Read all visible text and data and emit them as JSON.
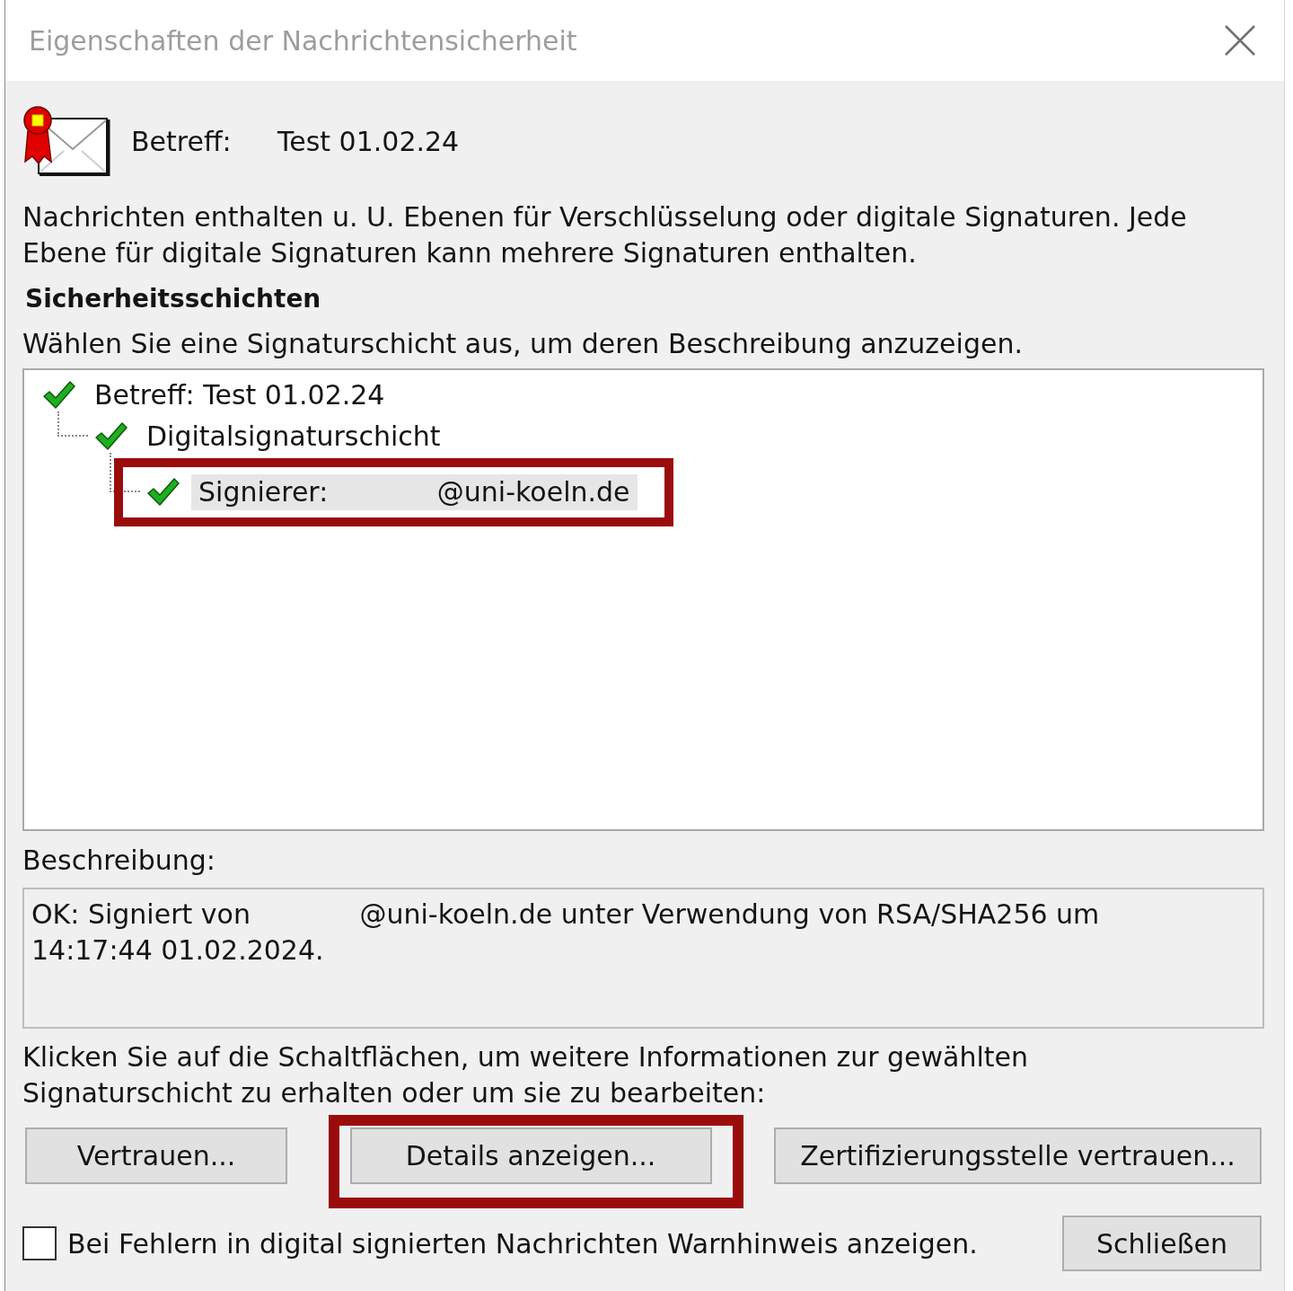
{
  "window": {
    "title": "Eigenschaften der Nachrichtensicherheit"
  },
  "header": {
    "label": "Betreff:",
    "value": "Test 01.02.24"
  },
  "intro": "Nachrichten enthalten u. U. Ebenen für Verschlüsselung oder digitale Signaturen. Jede Ebene für digitale Signaturen kann mehrere Signaturen enthalten.",
  "layers_heading": "Sicherheitsschichten",
  "layers_hint": "Wählen Sie eine Signaturschicht aus, um deren Beschreibung anzuzeigen.",
  "layers_tree": [
    {
      "label": "Betreff: Test 01.02.24",
      "valid": true,
      "selected": false,
      "marked": false,
      "children": [
        {
          "label": "Digitalsignaturschicht",
          "valid": true,
          "selected": false,
          "marked": false,
          "children": [
            {
              "label": "Signierer:",
              "value": "@uni-koeln.de",
              "valid": true,
              "selected": true,
              "marked": true
            }
          ]
        }
      ]
    }
  ],
  "description": {
    "label": "Beschreibung:",
    "segments": [
      "OK: Signiert von",
      "@uni-koeln.de unter Verwendung von RSA/SHA256 um 14:17:44 01.02.2024."
    ]
  },
  "buttons_hint": "Klicken Sie auf die Schaltflächen, um weitere Informationen zur gewählten Signaturschicht zu erhalten oder um sie zu bearbeiten:",
  "action_buttons": [
    {
      "label": "Vertrauen...",
      "marked": false
    },
    {
      "label": "Details anzeigen...",
      "marked": true
    },
    {
      "label": "Zertifizierungsstelle vertrauen...",
      "marked": false
    }
  ],
  "warn_checkbox": {
    "label": "Bei Fehlern in digital signierten Nachrichten Warnhinweis anzeigen.",
    "checked": false
  },
  "close_button": "Schließen"
}
